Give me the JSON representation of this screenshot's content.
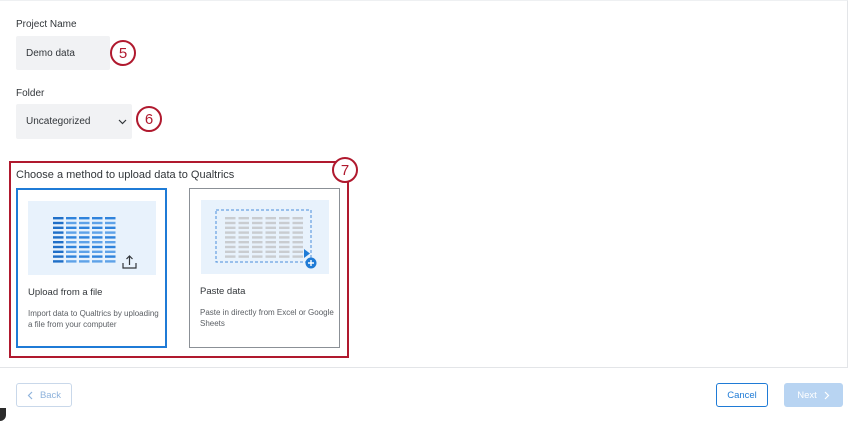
{
  "form": {
    "project_name_label": "Project Name",
    "project_name_value": "Demo data",
    "folder_label": "Folder",
    "folder_value": "Uncategorized"
  },
  "upload_section": {
    "title": "Choose a method to upload data to Qualtrics",
    "options": [
      {
        "title": "Upload from a file",
        "description": "Import data to Qualtrics by uploading a file from your computer",
        "selected": true
      },
      {
        "title": "Paste data",
        "description": "Paste in directly from Excel or Google Sheets",
        "selected": false
      }
    ]
  },
  "callouts": [
    "5",
    "6",
    "7"
  ],
  "footer": {
    "back_label": "Back",
    "cancel_label": "Cancel",
    "next_label": "Next"
  },
  "colors": {
    "accent": "#1f7bd6",
    "callout": "#b0192e",
    "field_bg": "#f1f2f4"
  },
  "icons": [
    "chevron-down-icon",
    "upload-icon",
    "add-circle-icon",
    "chevron-left-icon",
    "chevron-right-icon"
  ]
}
